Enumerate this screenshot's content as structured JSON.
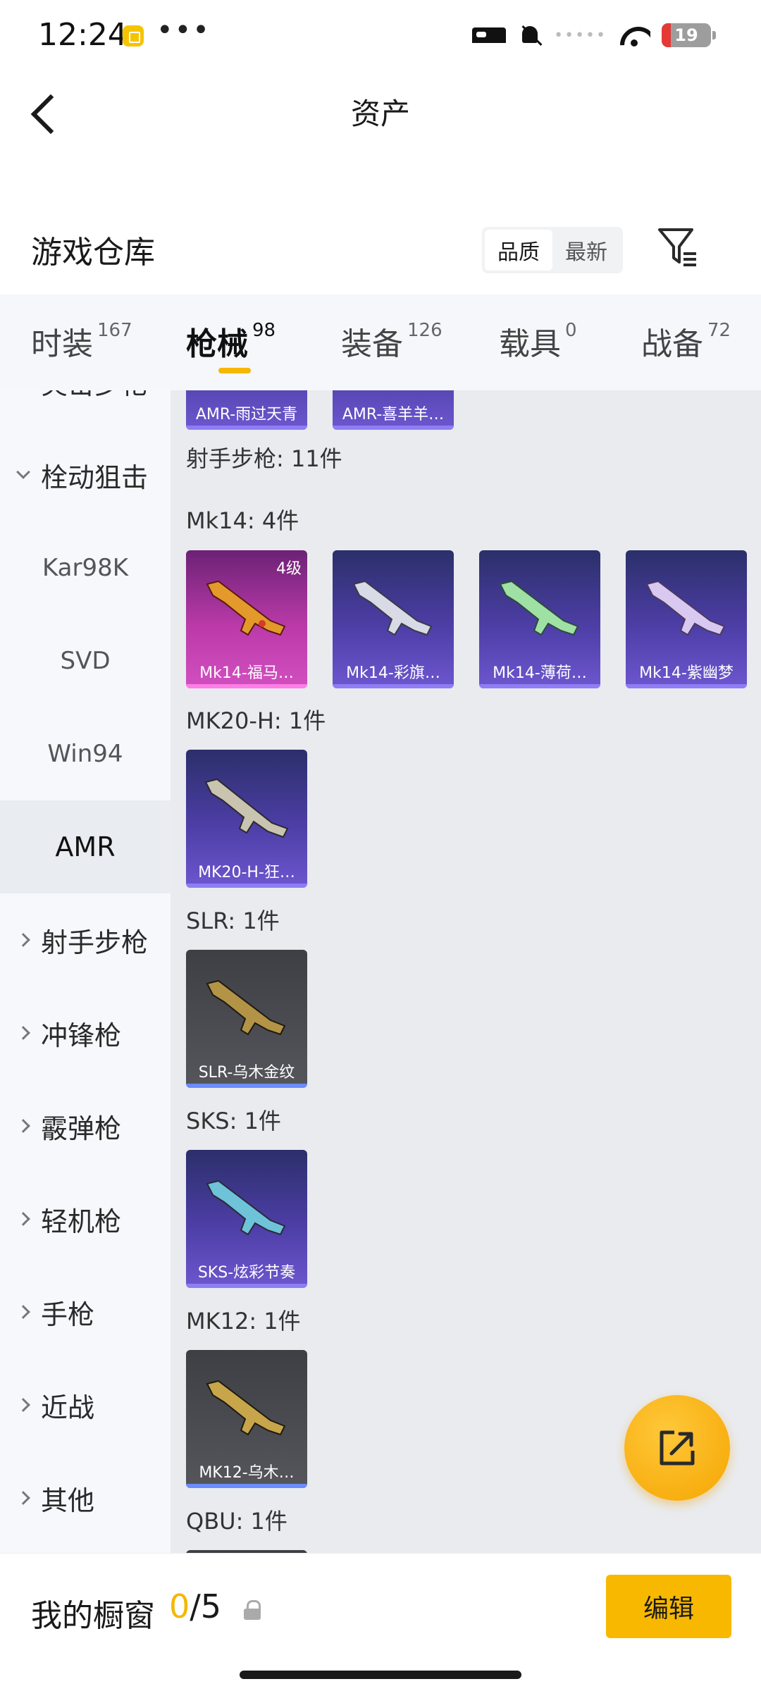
{
  "status_bar": {
    "time": "12:24",
    "dots": "•••",
    "battery": "19",
    "battery_level": 0.19,
    "signal_dots": "•••••"
  },
  "header": {
    "title": "资产"
  },
  "section": {
    "title": "游戏仓库",
    "sort_options": [
      "品质",
      "最新"
    ],
    "sort_active": 0
  },
  "tabs": [
    {
      "label": "时装",
      "count": "167"
    },
    {
      "label": "枪械",
      "count": "98"
    },
    {
      "label": "装备",
      "count": "126"
    },
    {
      "label": "载具",
      "count": "0"
    },
    {
      "label": "战备",
      "count": "72"
    }
  ],
  "active_tab": 1,
  "sidebar": {
    "partial_top": "突击步枪",
    "expanded": "栓动狙击",
    "subitems": [
      "Kar98K",
      "SVD",
      "Win94",
      "AMR"
    ],
    "active_sub": "AMR",
    "categories": [
      "射手步枪",
      "冲锋枪",
      "霰弹枪",
      "轻机枪",
      "手枪",
      "近战",
      "其他"
    ]
  },
  "content": {
    "top_cards": [
      "AMR-雨过天青",
      "AMR-喜羊羊…"
    ],
    "section_label": "射手步枪: 11件",
    "groups": [
      {
        "label": "Mk14: 4件",
        "items": [
          {
            "name": "Mk14-福马…",
            "level": "4级",
            "rarity": "pink"
          },
          {
            "name": "Mk14-彩旗…",
            "rarity": "purple"
          },
          {
            "name": "Mk14-薄荷…",
            "rarity": "purple"
          },
          {
            "name": "Mk14-紫幽梦",
            "rarity": "purple"
          }
        ]
      },
      {
        "label": "MK20-H: 1件",
        "items": [
          {
            "name": "MK20-H-狂…",
            "rarity": "purple"
          }
        ]
      },
      {
        "label": "SLR: 1件",
        "items": [
          {
            "name": "SLR-乌木金纹",
            "rarity": "gray"
          }
        ]
      },
      {
        "label": "SKS: 1件",
        "items": [
          {
            "name": "SKS-炫彩节奏",
            "rarity": "purple"
          }
        ]
      },
      {
        "label": "MK12: 1件",
        "items": [
          {
            "name": "MK12-乌木…",
            "rarity": "gray"
          }
        ]
      },
      {
        "label": "QBU: 1件",
        "items": []
      }
    ]
  },
  "bottom": {
    "label": "我的橱窗",
    "current": "0",
    "total": "/5",
    "edit_label": "编辑"
  },
  "colors": {
    "accent": "#f5b700",
    "purple_card": "#4d3ea6",
    "pink_card": "#bb3aa9",
    "gray_card": "#55565c"
  }
}
